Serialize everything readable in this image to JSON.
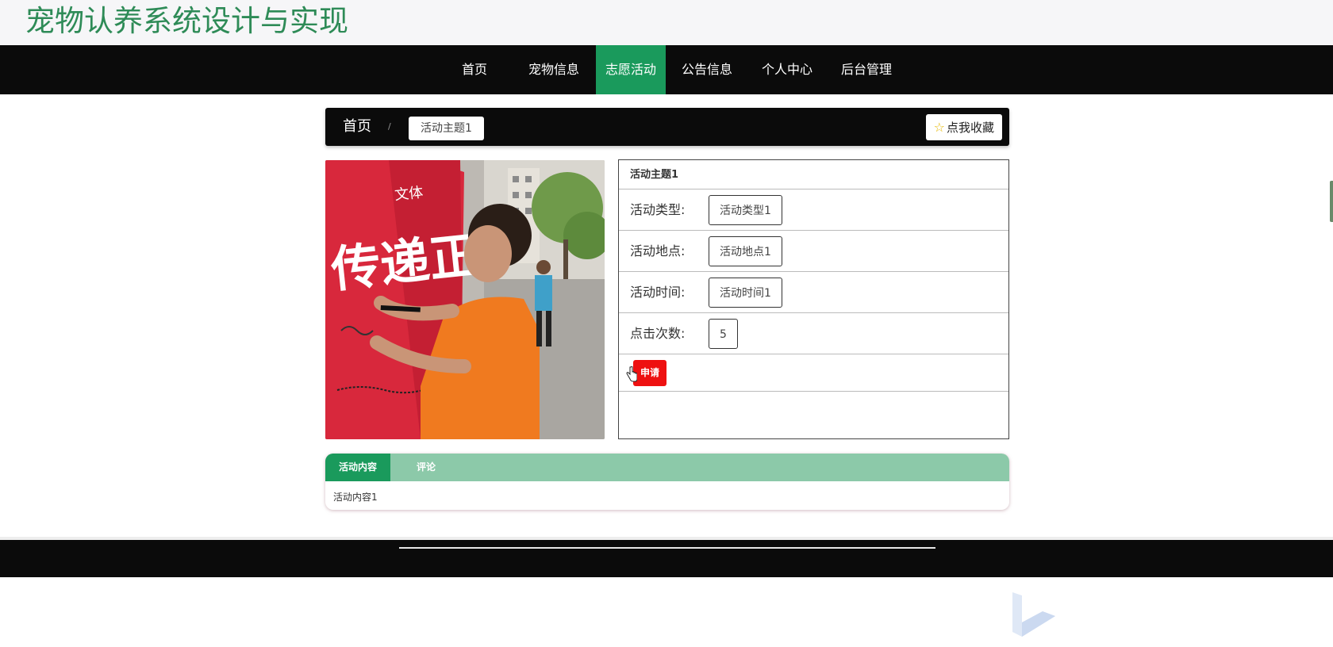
{
  "site": {
    "title": "宠物认养系统设计与实现"
  },
  "nav": {
    "items": [
      {
        "label": "首页"
      },
      {
        "label": "宠物信息"
      },
      {
        "label": "志愿活动"
      },
      {
        "label": "公告信息"
      },
      {
        "label": "个人中心"
      },
      {
        "label": "后台管理"
      }
    ],
    "active_index": 2
  },
  "breadcrumb": {
    "home": "首页",
    "separator": "/",
    "current": "活动主题1"
  },
  "favorite": {
    "icon": "star-icon",
    "label": "点我收藏"
  },
  "detail": {
    "title": "活动主题1",
    "rows": [
      {
        "label": "活动类型:",
        "value": "活动类型1"
      },
      {
        "label": "活动地点:",
        "value": "活动地点1"
      },
      {
        "label": "活动时间:",
        "value": "活动时间1"
      },
      {
        "label": "点击次数:",
        "value": "5"
      }
    ],
    "apply_label": "申请"
  },
  "tabs": {
    "items": [
      {
        "label": "活动内容"
      },
      {
        "label": "评论"
      }
    ],
    "active_index": 0,
    "content": "活动内容1"
  },
  "colors": {
    "brand_green": "#2e8b57",
    "active_green": "#1a9a5c",
    "tab_strip": "#8cc9a9",
    "apply_red": "#ee1111",
    "nav_black": "#0b0b0b"
  }
}
